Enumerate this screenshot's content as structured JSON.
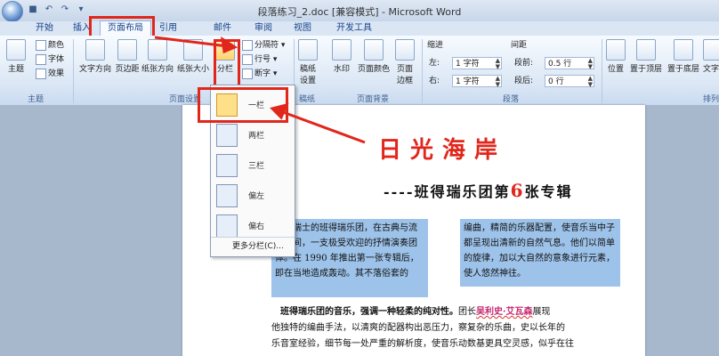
{
  "window": {
    "title": "段落练习_2.doc [兼容模式] - Microsoft Word"
  },
  "tabs": [
    "开始",
    "插入",
    "页面布局",
    "引用",
    "邮件",
    "审阅",
    "视图",
    "开发工具"
  ],
  "ribbon": {
    "theme_group": {
      "label": "主题",
      "main_button": "主题",
      "items": [
        "颜色",
        "字体",
        "效果"
      ]
    },
    "page_setup": {
      "label": "页面设置",
      "buttons": [
        "文字方向",
        "页边距",
        "纸张方向",
        "纸张大小",
        "分栏"
      ],
      "small": [
        "分隔符",
        "行号",
        "断字"
      ]
    },
    "background": {
      "label": "页面背景",
      "prefix_label": "稿纸",
      "prefix_button": "稿纸设置",
      "buttons": [
        "水印",
        "页面颜色",
        "页面边框"
      ]
    },
    "paragraph": {
      "label": "段落",
      "indent_header": "缩进",
      "spacing_header": "间距",
      "left_label": "左:",
      "left_value": "1 字符",
      "right_label": "右:",
      "right_value": "1 字符",
      "before_label": "段前:",
      "before_value": "0.5 行",
      "after_label": "段后:",
      "after_value": "0 行"
    },
    "arrange": {
      "label": "排列",
      "buttons": [
        "位置",
        "置于顶层",
        "置于底层",
        "文字"
      ]
    }
  },
  "columns_menu": {
    "items": [
      "一栏",
      "两栏",
      "三栏",
      "偏左",
      "偏右"
    ],
    "more": "更多分栏(C)..."
  },
  "document": {
    "title": "日光海岸",
    "subtitle_prefix": "----班得瑞乐团第",
    "subtitle_number": "6",
    "subtitle_suffix": "张专辑",
    "left_block": "来自瑞士的班得瑞乐团，在古典与流行之间，一支极受欢迎的抒情演奏团体。在 1990 年推出第一张专辑后，即在当地造成轰动。其不落俗套的",
    "right_block": "编曲，精简的乐器配置，使音乐当中子都呈现出清新的自然气息。他们以简单的旋律，加以大自然的意象进行元素，使人悠然神往。",
    "para_line1_bold": "班得瑞乐团的音乐，强调一种轻柔的纯对性。",
    "para_line1_rest": "团长",
    "para_line1_hl": "吴利史·艾瓦森",
    "para_line1_end": "展现",
    "para_line2": "他独特的编曲手法，以清爽的配器构出恶压力，察复杂的乐曲，史以长年的",
    "para_line3": "乐音室经验，细节每一处严重的解析度，使音乐动数基更具空灵感，似乎在往"
  }
}
